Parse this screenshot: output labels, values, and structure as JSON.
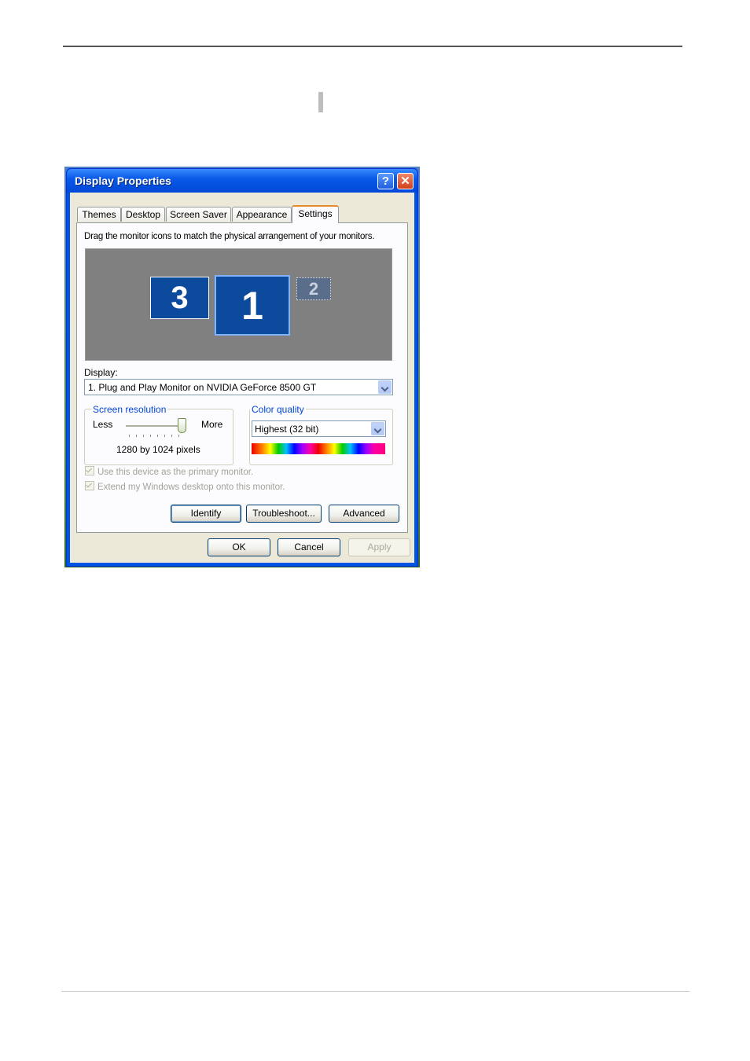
{
  "dialog": {
    "title": "Display Properties",
    "help_glyph": "?",
    "close_glyph": "✕"
  },
  "tabs": [
    {
      "label": "Themes"
    },
    {
      "label": "Desktop"
    },
    {
      "label": "Screen Saver"
    },
    {
      "label": "Appearance"
    },
    {
      "label": "Settings",
      "active": true
    }
  ],
  "settings": {
    "instruction": "Drag the monitor icons to match the physical arrangement of your monitors.",
    "monitors": [
      {
        "number": "3"
      },
      {
        "number": "1",
        "selected": true
      },
      {
        "number": "2",
        "inactive": true
      }
    ],
    "display_label": "Display:",
    "display_value": "1. Plug and Play Monitor on NVIDIA GeForce 8500 GT",
    "screen_resolution": {
      "legend": "Screen resolution",
      "less": "Less",
      "more": "More",
      "value": "1280 by 1024 pixels",
      "slider_fraction": 0.9
    },
    "color_quality": {
      "legend": "Color quality",
      "value": "Highest (32 bit)"
    },
    "checkboxes": {
      "primary": "Use this device as the primary monitor.",
      "extend": "Extend my Windows desktop onto this monitor."
    },
    "buttons": {
      "identify": "Identify",
      "troubleshoot": "Troubleshoot...",
      "advanced": "Advanced"
    }
  },
  "footer_buttons": {
    "ok": "OK",
    "cancel": "Cancel",
    "apply": "Apply"
  },
  "colors": {
    "accent_title": "#0054e3",
    "group_legend": "#0046d5",
    "monitor_fill": "#0b4a9c"
  }
}
